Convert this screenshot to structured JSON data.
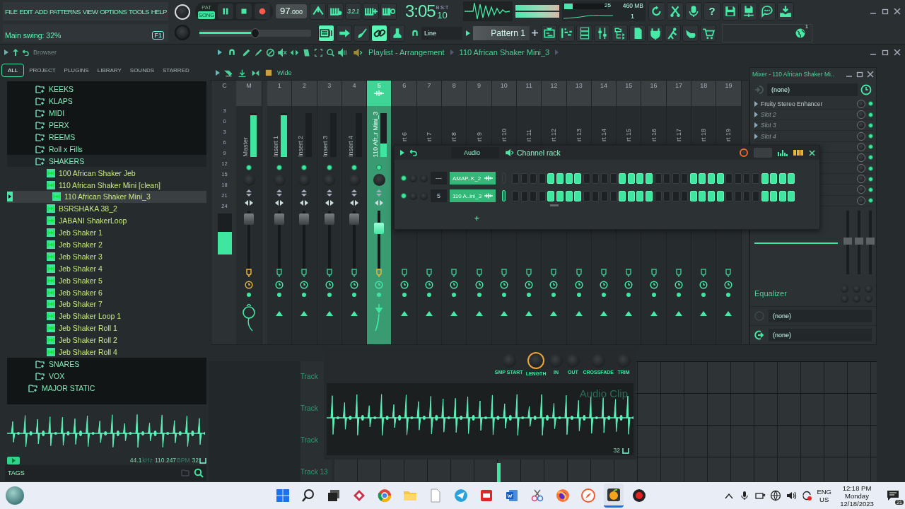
{
  "menu": [
    "FILE",
    "EDIT",
    "ADD",
    "PATTERNS",
    "VIEW",
    "OPTIONS",
    "TOOLS",
    "HELP"
  ],
  "hint": "Main swing: 32%",
  "hint_key": "F1",
  "transport": {
    "modes": [
      {
        "label": "PAT",
        "selected": false
      },
      {
        "label": "SONG",
        "selected": true
      }
    ]
  },
  "tempo": {
    "whole": "97",
    "fraction": ".000"
  },
  "countdown": "3.2.1",
  "time": {
    "main": "3:05",
    "ticks": "10",
    "unit": "B:S:T"
  },
  "master_volume": {
    "level": 0.5
  },
  "monitor": {
    "cpu": "25",
    "cpu_meter": {
      "level": 0.2
    },
    "memory": "460 MB",
    "voices": "1"
  },
  "help": "?",
  "snap": "Line",
  "pattern": "Pattern 1",
  "online_badge": "1",
  "browser": {
    "title": "Browser",
    "tabs": [
      {
        "label": "ALL",
        "selected": true
      },
      {
        "label": "PROJECT",
        "selected": false
      },
      {
        "label": "PLUGINS",
        "selected": false
      },
      {
        "label": "LIBRARY",
        "selected": false
      },
      {
        "label": "SOUNDS",
        "selected": false
      },
      {
        "label": "STARRED",
        "selected": false
      }
    ],
    "tree": [
      {
        "children": [
          {
            "label": "KEEKS",
            "kind": "folder",
            "expanded": false
          },
          {
            "label": "KLAPS",
            "kind": "folder",
            "expanded": false
          },
          {
            "label": "MIDI",
            "kind": "folder",
            "expanded": false
          },
          {
            "label": "PERX",
            "kind": "folder",
            "expanded": false
          },
          {
            "label": "REEMS",
            "kind": "folder",
            "expanded": false
          },
          {
            "label": "Roll x Fills",
            "kind": "folder",
            "expanded": false
          },
          {
            "label": "SHAKERS",
            "kind": "folder",
            "expanded": true,
            "children": [
              {
                "label": "100 African Shaker Jeb",
                "kind": "audio",
                "selected": false
              },
              {
                "label": "110 African Shaker Mini [clean]",
                "kind": "audio",
                "selected": false,
                "children": [
                  {
                    "label": "110 African Shaker Mini_3",
                    "kind": "audio",
                    "selected": true
                  }
                ]
              },
              {
                "label": "BSRSHAKA 38_2",
                "kind": "audio",
                "selected": false
              },
              {
                "label": "JABANI ShakerLoop",
                "kind": "audio",
                "selected": false
              },
              {
                "label": "Jeb Shaker 1",
                "kind": "audio",
                "selected": false
              },
              {
                "label": "Jeb Shaker 2",
                "kind": "audio",
                "selected": false
              },
              {
                "label": "Jeb Shaker 3",
                "kind": "audio",
                "selected": false
              },
              {
                "label": "Jeb Shaker 4",
                "kind": "audio",
                "selected": false
              },
              {
                "label": "Jeb Shaker 5",
                "kind": "audio",
                "selected": false
              },
              {
                "label": "Jeb Shaker 6",
                "kind": "audio",
                "selected": false
              },
              {
                "label": "Jeb Shaker 7",
                "kind": "audio",
                "selected": false
              },
              {
                "label": "Jeb Shaker Loop 1",
                "kind": "audio",
                "selected": false
              },
              {
                "label": "Jeb Shaker Roll 1",
                "kind": "audio",
                "selected": false
              },
              {
                "label": "Jeb Shaker Roll 2",
                "kind": "audio",
                "selected": false
              },
              {
                "label": "Jeb Shaker Roll 4",
                "kind": "audio",
                "selected": false
              }
            ]
          },
          {
            "label": "SNARES",
            "kind": "folder",
            "expanded": false
          },
          {
            "label": "VOX",
            "kind": "folder",
            "expanded": false
          }
        ]
      },
      {
        "label": "MAJOR STATIC",
        "kind": "folder",
        "expanded": false
      }
    ],
    "sample": {
      "rate": "44.1",
      "rate_unit": "kHz",
      "tempo": "110.247",
      "tempo_unit": "BPM",
      "beats": "32"
    },
    "tags_label": "TAGS"
  },
  "playlist": {
    "title": "Playlist - Arrangement",
    "clip": "110 African Shaker Mini_3",
    "stereo": "Wide",
    "tracks": [
      "Track",
      "Track",
      "Track",
      "Track 13"
    ]
  },
  "mixer": {
    "title": "Mixer - 110 African Shaker Mi..",
    "scale": {
      "label": "C",
      "marks": [
        "3",
        "0",
        "3",
        "6",
        "9",
        "12",
        "15",
        "18",
        "21",
        "24"
      ],
      "meter": {
        "level": 0.55
      }
    },
    "strips": [
      {
        "number": "M",
        "name": "Master",
        "selected": false,
        "meter": {
          "level": 0.95
        },
        "volume": {
          "level": 0.85
        }
      },
      {
        "number": "1",
        "name": "Insert 1",
        "selected": false,
        "meter": {
          "level": 0.95
        },
        "volume": {
          "level": 0.85
        }
      },
      {
        "number": "2",
        "name": "Insert 2",
        "selected": false,
        "meter": {
          "level": 0
        },
        "volume": {
          "level": 0.85
        }
      },
      {
        "number": "3",
        "name": "Insert 3",
        "selected": false,
        "meter": {
          "level": 0
        },
        "volume": {
          "level": 0.85
        }
      },
      {
        "number": "4",
        "name": "Insert 4",
        "selected": false,
        "meter": {
          "level": 0
        },
        "volume": {
          "level": 0.85
        }
      },
      {
        "number": "5",
        "name": "110 Afr..r Mini_3",
        "selected": true,
        "meter": {
          "level": 0.3
        },
        "volume": {
          "level": 0.7
        }
      },
      {
        "number": "6",
        "name": "rt 6",
        "selected": false
      },
      {
        "number": "7",
        "name": "rt 7",
        "selected": false
      },
      {
        "number": "8",
        "name": "rt 8",
        "selected": false
      },
      {
        "number": "9",
        "name": "rt 9",
        "selected": false
      },
      {
        "number": "10",
        "name": "rt 10",
        "selected": false
      },
      {
        "number": "11",
        "name": "rt 11",
        "selected": false
      },
      {
        "number": "12",
        "name": "rt 12",
        "selected": false
      },
      {
        "number": "13",
        "name": "rt 13",
        "selected": false
      },
      {
        "number": "14",
        "name": "rt 14",
        "selected": false
      },
      {
        "number": "15",
        "name": "rt 15",
        "selected": false
      },
      {
        "number": "16",
        "name": "rt 16",
        "selected": false
      },
      {
        "number": "17",
        "name": "rt 17",
        "selected": false
      },
      {
        "number": "18",
        "name": "rt 18",
        "selected": false
      },
      {
        "number": "19",
        "name": "rt 19",
        "selected": false
      }
    ],
    "input": "(none)",
    "slots": [
      {
        "label": "Fruity Stereo Enhancer",
        "empty": false
      },
      {
        "label": "Slot 2",
        "empty": true
      },
      {
        "label": "Slot 3",
        "empty": true
      },
      {
        "label": "Slot 4",
        "empty": true
      }
    ],
    "eq_label": "Equalizer",
    "outputs": [
      "(none)",
      "(none)"
    ]
  },
  "channel_rack": {
    "title": "Channel rack",
    "filter": "Audio",
    "channels": [
      {
        "number": "---",
        "name": "AMAP..K_2",
        "selected": false,
        "steps": [
          false,
          false,
          false,
          false,
          true,
          true,
          true,
          true,
          false,
          false,
          false,
          false,
          true,
          true,
          true,
          true,
          false,
          false,
          false,
          false,
          true,
          true,
          true,
          true,
          false,
          false,
          false,
          false,
          true,
          true,
          true,
          true
        ]
      },
      {
        "number": "5",
        "name": "110 A..ini_3",
        "selected": true,
        "steps": [
          false,
          false,
          false,
          false,
          true,
          true,
          true,
          true,
          false,
          false,
          false,
          false,
          true,
          true,
          true,
          true,
          false,
          false,
          false,
          false,
          true,
          true,
          true,
          true,
          false,
          false,
          false,
          false,
          true,
          true,
          true,
          true
        ]
      }
    ],
    "add": "+"
  },
  "audio_clip": {
    "title": "Audio Clip",
    "knobs": [
      {
        "label": "SMP START",
        "selected": false
      },
      {
        "label": "LENGTH",
        "selected": true
      },
      {
        "label": "IN",
        "selected": false
      },
      {
        "label": "OUT",
        "selected": false
      },
      {
        "label": "CROSSFADE",
        "selected": false
      },
      {
        "label": "TRIM",
        "selected": false
      }
    ],
    "beats": "32"
  },
  "taskbar": {
    "apps": [
      {
        "kind": "start",
        "selected": false
      },
      {
        "kind": "search",
        "selected": false
      },
      {
        "kind": "taskview",
        "selected": false
      },
      {
        "kind": "diamond",
        "selected": false
      },
      {
        "kind": "chrome",
        "selected": false
      },
      {
        "kind": "folder",
        "selected": false
      },
      {
        "kind": "document",
        "selected": false
      },
      {
        "kind": "plane",
        "selected": false
      },
      {
        "kind": "redbox",
        "selected": false
      },
      {
        "kind": "word",
        "selected": false
      },
      {
        "kind": "scissors",
        "selected": false
      },
      {
        "kind": "firefox",
        "selected": false
      },
      {
        "kind": "compass",
        "selected": false
      },
      {
        "kind": "fruit",
        "selected": true
      },
      {
        "kind": "record",
        "selected": false
      }
    ],
    "lang": "ENG",
    "region": "US",
    "time": "12:18 PM",
    "day": "Monday",
    "date": "12/18/2023",
    "notifications": "21"
  }
}
